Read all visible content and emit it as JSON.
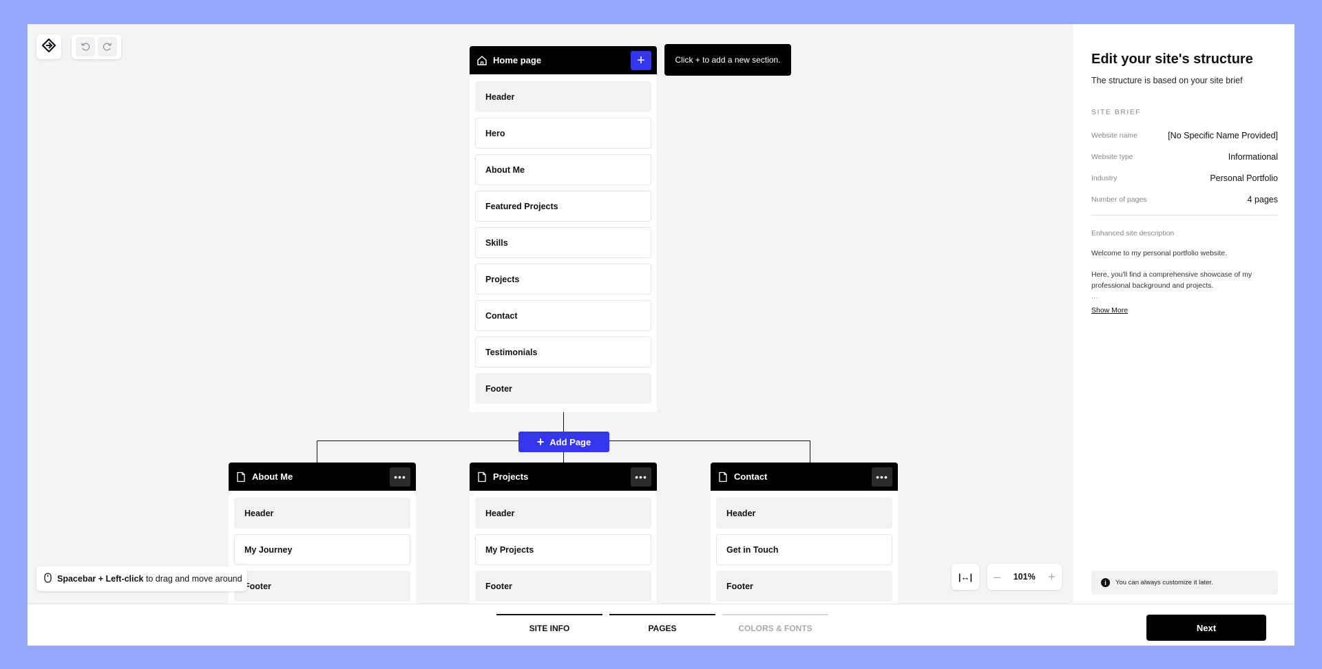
{
  "toolbar": {
    "logo_icon": "diamond-logo-icon",
    "undo_icon": "undo-icon",
    "redo_icon": "redo-icon"
  },
  "tooltip": "Click + to add a new section.",
  "home_page": {
    "title": "Home page",
    "add_label": "+",
    "sections": [
      "Header",
      "Hero",
      "About Me",
      "Featured Projects",
      "Skills",
      "Projects",
      "Contact",
      "Testimonials",
      "Footer"
    ]
  },
  "add_page_label": "Add Page",
  "add_page_icon": "+",
  "more_label": "•••",
  "subpages": [
    {
      "title": "About Me",
      "sections": [
        "Header",
        "My Journey",
        "Footer"
      ]
    },
    {
      "title": "Projects",
      "sections": [
        "Header",
        "My Projects",
        "Footer"
      ]
    },
    {
      "title": "Contact",
      "sections": [
        "Header",
        "Get in Touch",
        "Footer"
      ]
    }
  ],
  "hint": {
    "keys": "Spacebar + Left-click",
    "text": "to drag and move around"
  },
  "fit_label": "|↔|",
  "zoom": {
    "minus": "–",
    "value": "101%",
    "plus": "+"
  },
  "panel": {
    "title": "Edit your site's structure",
    "subtitle": "The structure is based on your site brief",
    "brief_label": "SITE BRIEF",
    "brief": [
      {
        "key": "Website name",
        "value": "[No Specific Name Provided]"
      },
      {
        "key": "Website type",
        "value": "Informational"
      },
      {
        "key": "Industry",
        "value": "Personal Portfolio"
      },
      {
        "key": "Number of pages",
        "value": "4 pages"
      }
    ],
    "enhanced_label": "Enhanced site description",
    "desc_1": "Welcome to my personal portfolio website.",
    "desc_2": "Here, you'll find a comprehensive showcase of my professional background and projects.",
    "desc_dots": "...",
    "show_more": "Show More",
    "note_icon": "i",
    "note": "You can always customize it later."
  },
  "steps": [
    {
      "label": "SITE INFO",
      "state": "done"
    },
    {
      "label": "PAGES",
      "state": "active"
    },
    {
      "label": "COLORS & FONTS",
      "state": "pending"
    }
  ],
  "next_label": "Next"
}
